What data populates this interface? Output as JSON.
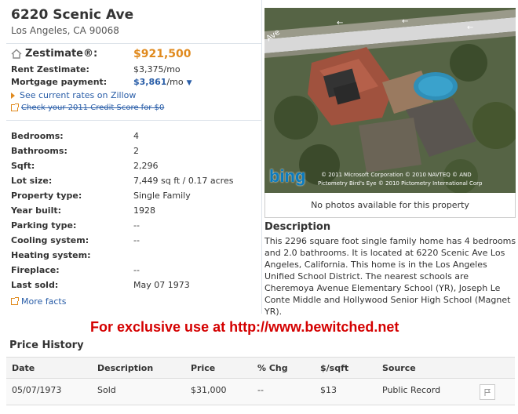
{
  "address": {
    "street": "6220 Scenic Ave",
    "city_state_zip": "Los Angeles, CA 90068"
  },
  "estimates": {
    "zestimate_label": "Zestimate®:",
    "zestimate_value": "$921,500",
    "rent_label": "Rent Zestimate:",
    "rent_value": "$3,375/mo",
    "mortgage_label": "Mortgage payment:",
    "mortgage_value": "$3,861",
    "mortgage_suffix": "/mo",
    "rates_link": "See current rates on Zillow",
    "credit_link": "Check your 2011 Credit Score for $0"
  },
  "facts": [
    {
      "label": "Bedrooms:",
      "value": "4"
    },
    {
      "label": "Bathrooms:",
      "value": "2"
    },
    {
      "label": "Sqft:",
      "value": "2,296"
    },
    {
      "label": "Lot size:",
      "value": "7,449 sq ft / 0.17 acres"
    },
    {
      "label": "Property type:",
      "value": "Single Family"
    },
    {
      "label": "Year built:",
      "value": "1928"
    },
    {
      "label": "Parking type:",
      "value": "--"
    },
    {
      "label": "Cooling system:",
      "value": "--"
    },
    {
      "label": "Heating system:",
      "value": ""
    },
    {
      "label": "Fireplace:",
      "value": "--"
    },
    {
      "label": "Last sold:",
      "value": "May 07 1973"
    }
  ],
  "more_facts": "More facts",
  "photo": {
    "street_label": "Ave",
    "bing": "bing",
    "copyright1": "© 2011 Microsoft Corporation © 2010 NAVTEQ © AND",
    "copyright2": "Pictometry Bird's Eye © 2010 Pictometry International Corp",
    "caption": "No photos available for this property"
  },
  "description": {
    "title": "Description",
    "text": "This 2296 square foot single family home has 4 bedrooms and 2.0 bathrooms. It is located at 6220 Scenic Ave Los Angeles, California. This home is in the Los Angeles Unified School District. The nearest schools are Cheremoya Avenue Elementary School (YR), Joseph Le Conte Middle and Hollywood Senior High School (Magnet YR)."
  },
  "watermark": "For exclusive use at http://www.bewitched.net",
  "price_history": {
    "title": "Price History",
    "headers": {
      "date": "Date",
      "description": "Description",
      "price": "Price",
      "chg": "% Chg",
      "sqft": "$/sqft",
      "source": "Source"
    },
    "rows": [
      {
        "date": "05/07/1973",
        "description": "Sold",
        "price": "$31,000",
        "chg": "--",
        "sqft": "$13",
        "source": "Public Record"
      }
    ]
  },
  "colors": {
    "accent": "#e08a1e",
    "link": "#2a5ea8",
    "watermark": "#d40000"
  },
  "icons": [
    "house-icon",
    "triangle-right-icon",
    "external-link-icon",
    "more-facts-icon",
    "flag-icon",
    "dropdown-caret-icon"
  ]
}
